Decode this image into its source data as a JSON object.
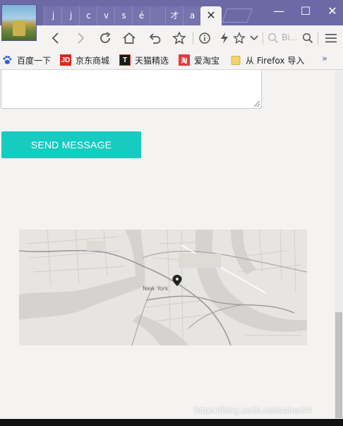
{
  "tabs": {
    "inactive": [
      "j",
      "j",
      "c",
      "v",
      "s",
      "é",
      "",
      "才",
      "a"
    ],
    "active_close": "✕"
  },
  "window": {
    "minimize": "—",
    "maximize": "☐",
    "close": "✕"
  },
  "toolbar": {
    "search_placeholder": "Bi..."
  },
  "bookmarks": [
    {
      "label": "百度一下",
      "icon": "paw-icon",
      "icon_text": "",
      "color": "#2a5ed6"
    },
    {
      "label": "京东商城",
      "icon": "jd-icon",
      "icon_text": "JD",
      "color": "#e1251b"
    },
    {
      "label": "天猫精选",
      "icon": "tmall-icon",
      "icon_text": "T",
      "color": "#1a1a1a"
    },
    {
      "label": "爱淘宝",
      "icon": "taobao-icon",
      "icon_text": "淘",
      "color": "#e4393c"
    },
    {
      "label": "从 Firefox 导入",
      "icon": "folder-icon",
      "icon_text": "",
      "color": "#f3d36b"
    }
  ],
  "bookmarks_more": "»",
  "form": {
    "send_label": "SEND MESSAGE"
  },
  "map": {
    "city_label": "New York"
  },
  "watermark": "https://blog.csdn.net/saber04",
  "colors": {
    "tabbar": "#6c69a6",
    "accent_button": "#16cbc0"
  }
}
